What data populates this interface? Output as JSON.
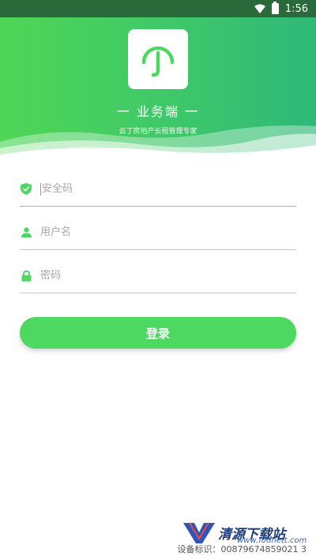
{
  "status_bar": {
    "time": "1:56",
    "icons": [
      "wifi-icon",
      "battery-icon"
    ]
  },
  "header": {
    "logo_icon": "umbrella-handle-icon",
    "title": "一 业务端 一",
    "subtitle": "云丁房地产长租管理专家",
    "gradient_colors": [
      "#4fd655",
      "#2fb878"
    ]
  },
  "form": {
    "security_code": {
      "icon": "shield-check-icon",
      "placeholder": "安全码",
      "value": ""
    },
    "username": {
      "icon": "user-icon",
      "placeholder": "用户名",
      "value": ""
    },
    "password": {
      "icon": "lock-icon",
      "placeholder": "密码",
      "value": ""
    },
    "login_label": "登录"
  },
  "footer": {
    "device_id_label": "设备标识：",
    "device_id": "00879674859021 3",
    "watermark_name": "清源下载站",
    "watermark_url": "www.fotinett.com"
  },
  "colors": {
    "accent": "#4cd861",
    "active_underline": "#6cd88a"
  }
}
